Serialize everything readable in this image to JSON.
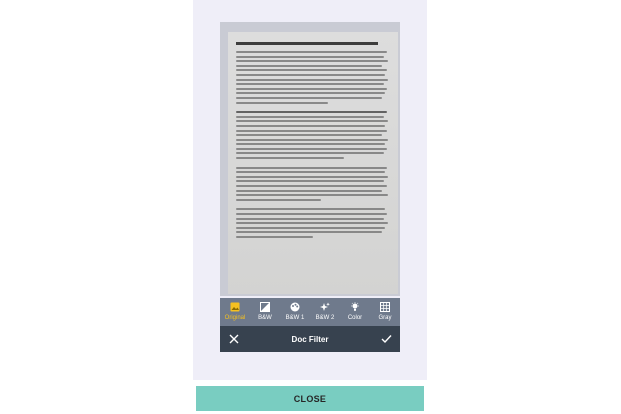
{
  "filters": [
    {
      "label": "Original",
      "icon": "image-icon",
      "active": true
    },
    {
      "label": "B&W",
      "icon": "bw-icon",
      "active": false
    },
    {
      "label": "B&W 1",
      "icon": "palette-icon",
      "active": false
    },
    {
      "label": "B&W 2",
      "icon": "sparkle-icon",
      "active": false
    },
    {
      "label": "Color",
      "icon": "bulb-icon",
      "active": false
    },
    {
      "label": "Gray",
      "icon": "grid-icon",
      "active": false
    }
  ],
  "bottombar": {
    "title": "Doc Filter"
  },
  "close_button": {
    "label": "CLOSE"
  },
  "colors": {
    "accent_active": "#f5c020",
    "toolbar": "#6f7a8c",
    "bottombar": "#37424f",
    "close_button": "#79cdc1"
  }
}
